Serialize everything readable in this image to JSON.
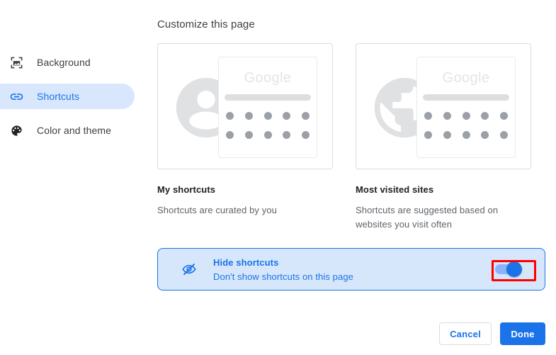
{
  "page": {
    "title": "Customize this page"
  },
  "sidebar": {
    "items": [
      {
        "id": "background",
        "label": "Background",
        "icon": "image-icon",
        "selected": false
      },
      {
        "id": "shortcuts",
        "label": "Shortcuts",
        "icon": "link-icon",
        "selected": true
      },
      {
        "id": "color-and-theme",
        "label": "Color and theme",
        "icon": "palette-icon",
        "selected": false
      }
    ]
  },
  "main": {
    "cards": [
      {
        "id": "my-shortcuts",
        "title": "My shortcuts",
        "description": "Shortcuts are curated by you",
        "preview": {
          "glyph": "person-avatar-icon",
          "logo_text": "Google",
          "dot_rows": 2,
          "dots_per_row": 5
        }
      },
      {
        "id": "most-visited-sites",
        "title": "Most visited sites",
        "description": "Shortcuts are suggested based on websites you visit often",
        "preview": {
          "glyph": "globe-icon",
          "logo_text": "Google",
          "dot_rows": 2,
          "dots_per_row": 5
        }
      }
    ],
    "hide_shortcuts": {
      "icon": "eye-off-icon",
      "title": "Hide shortcuts",
      "subtitle": "Don't show shortcuts on this page",
      "toggle_state": "on"
    }
  },
  "footer": {
    "cancel_label": "Cancel",
    "done_label": "Done"
  },
  "colors": {
    "accent": "#1a73e8",
    "selected_pill": "#d9e7fd",
    "hide_row_bg": "#d7e7fb",
    "annotation": "#ff0000",
    "toggle_track": "#8ab4f8",
    "muted_text": "#5f6368",
    "glyph_gray": "#dfe1e3",
    "dot_gray": "#9aa0a6"
  }
}
